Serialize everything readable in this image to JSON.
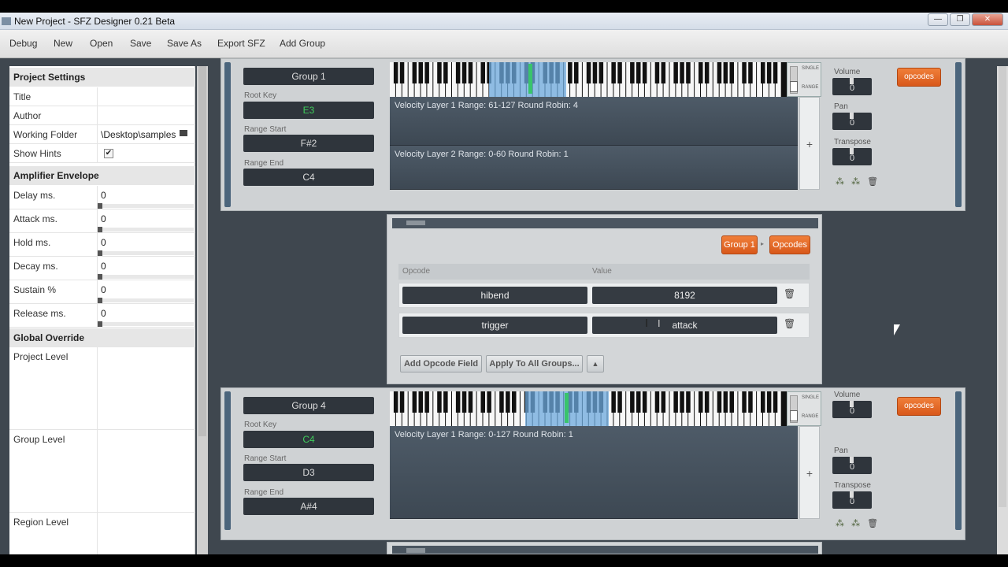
{
  "window": {
    "title": "New Project - SFZ Designer 0.21 Beta"
  },
  "menu": [
    "Debug",
    "New",
    "Open",
    "Save",
    "Save As",
    "Export SFZ",
    "Add Group"
  ],
  "project_settings": {
    "heading": "Project Settings",
    "title_label": "Title",
    "author_label": "Author",
    "folder_label": "Working Folder",
    "folder_value": "\\Desktop\\samples",
    "hints_label": "Show Hints",
    "hints_checked": "✔"
  },
  "amp_envelope": {
    "heading": "Amplifier Envelope",
    "rows": [
      {
        "label": "Delay ms.",
        "value": "0"
      },
      {
        "label": "Attack ms.",
        "value": "0"
      },
      {
        "label": "Hold ms.",
        "value": "0"
      },
      {
        "label": "Decay ms.",
        "value": "0"
      },
      {
        "label": "Sustain %",
        "value": "0"
      },
      {
        "label": "Release ms.",
        "value": "0"
      }
    ]
  },
  "global_override": {
    "heading": "Global Override",
    "levels": [
      "Project Level",
      "Group Level",
      "Region Level"
    ]
  },
  "labels": {
    "root_key": "Root Key",
    "range_start": "Range Start",
    "range_end": "Range End",
    "volume": "Volume",
    "pan": "Pan",
    "transpose": "Transpose",
    "single": "SINGLE",
    "range": "RANGE",
    "opcodes_button": "opcodes",
    "plus": "+"
  },
  "groups": [
    {
      "name": "Group 1",
      "root_key": "E3",
      "range_start": "F#2",
      "range_end": "C4",
      "volume": "0",
      "pan": "0",
      "transpose": "0",
      "layers": [
        "Velocity Layer 1     Range: 61-127     Round Robin: 4",
        "Velocity Layer 2     Range: 0-60     Round Robin: 1"
      ]
    },
    {
      "name": "Group 4",
      "root_key": "C4",
      "range_start": "D3",
      "range_end": "A#4",
      "volume": "0",
      "pan": "0",
      "transpose": "0",
      "layers": [
        "Velocity Layer 1     Range: 0-127     Round Robin: 1"
      ]
    }
  ],
  "opcode_panel": {
    "breadcrumb_group": "Group 1",
    "breadcrumb_opcodes": "Opcodes",
    "col_opcode": "Opcode",
    "col_value": "Value",
    "rows": [
      {
        "opcode": "hibend",
        "value": "8192"
      },
      {
        "opcode": "trigger",
        "value": "attack"
      }
    ],
    "add_button": "Add Opcode Field",
    "apply_button": "Apply To All Groups...",
    "up_button": "▲"
  },
  "icons": {
    "trash": "trash-icon",
    "folder": "folder-icon",
    "close": "close-icon"
  },
  "colors": {
    "accent_orange": "#e8682a",
    "green_key": "#3fce5b",
    "selection_blue": "#6ca8dc"
  }
}
